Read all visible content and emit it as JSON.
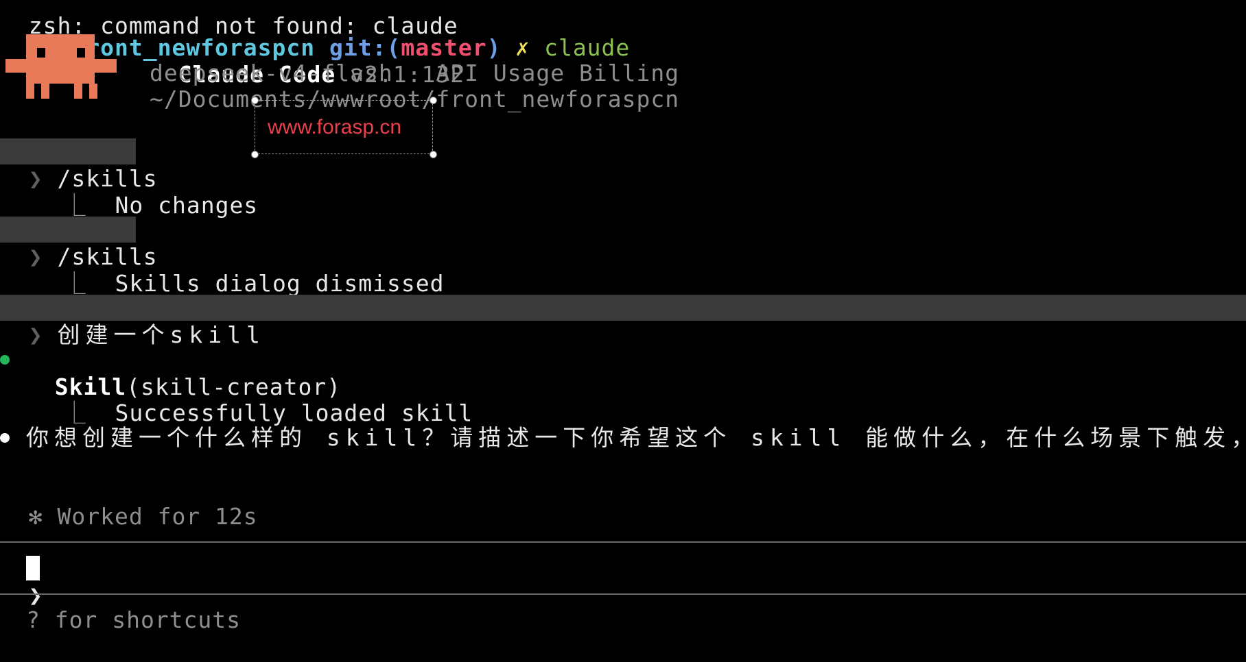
{
  "terminal": {
    "top_clip_line": "zsh: command not found: claude",
    "shell_prompt": {
      "arrow": "→",
      "directory": "front_newforaspcn",
      "git_prefix": "git:(",
      "branch": "master",
      "git_suffix": ")",
      "dirty_mark": "✗",
      "command": "claude"
    },
    "header": {
      "app_name": "Claude Code",
      "version": "v2.1.132",
      "model_line": "deepseek-v4-flash · API Usage Billing",
      "path": "~/Documents/wwwroot/front_newforaspcn"
    },
    "watermark": "www.forasp.cn",
    "transcript": [
      {
        "chevron": "❯",
        "command": "/skills",
        "result": "No changes"
      },
      {
        "chevron": "❯",
        "command": "/skills",
        "result": "Skills dialog dismissed"
      }
    ],
    "tree_glyph": "⎿",
    "user_message": {
      "chevron": "❯",
      "text": "创建一个skill"
    },
    "tool_call": {
      "name": "Skill",
      "args": "(skill-creator)",
      "result": "Successfully loaded skill"
    },
    "assistant_message": "你想创建一个什么样的 skill？请描述一下你希望这个 skill 能做什么，在什么场景下触发，以及期",
    "status": {
      "glyph": "✻",
      "text": "Worked for 12s"
    },
    "input": {
      "chevron": "❯",
      "value": ""
    },
    "footer_hint": "? for shortcuts"
  },
  "colors": {
    "background": "#000000",
    "directory": "#5fc8e0",
    "git_label": "#6ea0e8",
    "branch": "#f0506e",
    "claude_mascot": "#e87a5a",
    "tool_dot": "#22b85a",
    "highlight_bg": "#3a3a3a",
    "watermark": "#e8404a"
  },
  "icons": {
    "mascot": "claude-pixel-mascot-icon",
    "tool_status": "green-dot-icon",
    "message_bullet": "white-dot-icon"
  }
}
